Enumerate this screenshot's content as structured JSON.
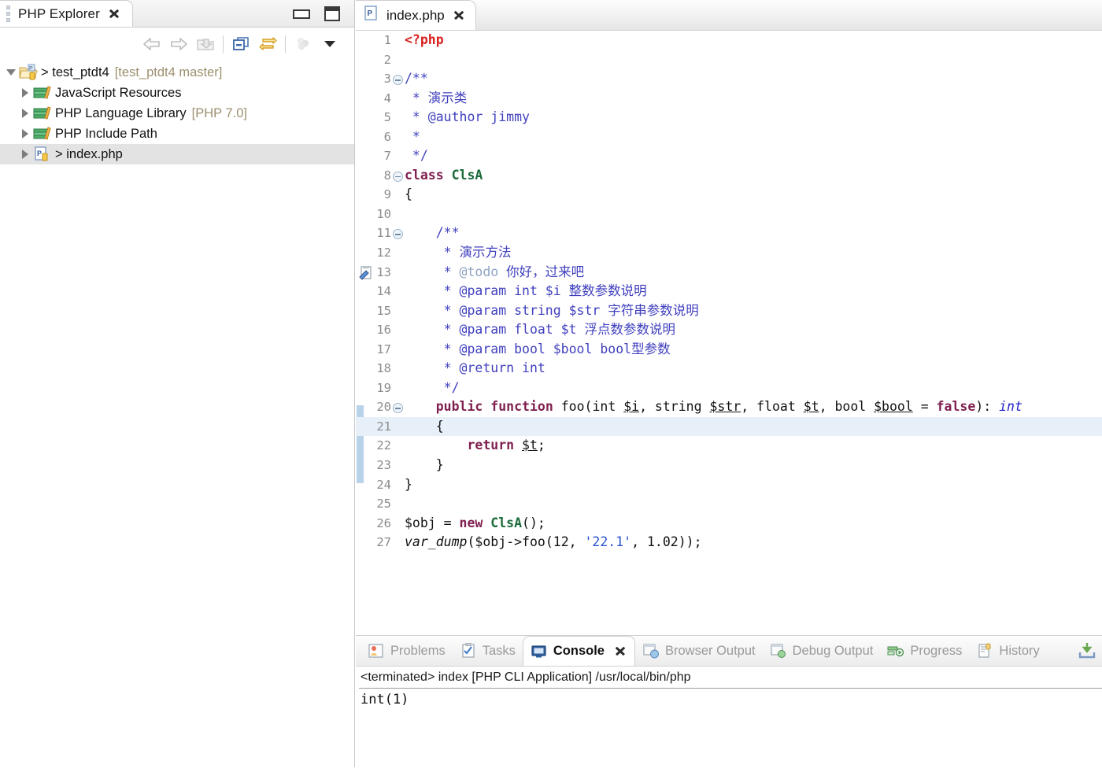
{
  "explorer": {
    "tab_title": "PHP Explorer",
    "close_icon": "close-x-icon",
    "view_menu_icon": "view-menu-icon",
    "window_controls": [
      {
        "name": "minimize-icon",
        "label": "Minimize"
      },
      {
        "name": "maximize-icon",
        "label": "Maximize"
      }
    ],
    "toolbar": [
      {
        "name": "back-icon",
        "label": "Back"
      },
      {
        "name": "forward-icon",
        "label": "Forward"
      },
      {
        "name": "up-folder-icon",
        "label": "Up"
      },
      {
        "name": "collapse-all-icon",
        "label": "Collapse All"
      },
      {
        "name": "link-with-editor-icon",
        "label": "Link with Editor"
      },
      {
        "name": "filters-icon",
        "label": "Filters"
      },
      {
        "name": "view-menu-chevron-icon",
        "label": "View Menu"
      }
    ],
    "tree": [
      {
        "label": "test_ptdt4",
        "prefix": "> ",
        "suffix": "[test_ptdt4 master]",
        "icon": "project-folder-icon",
        "expanded": true,
        "level": 0,
        "selected": false
      },
      {
        "label": "JavaScript Resources",
        "prefix": "",
        "suffix": "",
        "icon": "library-books-icon",
        "expanded": false,
        "level": 1,
        "selected": false
      },
      {
        "label": "PHP Language Library",
        "prefix": "",
        "suffix": "[PHP 7.0]",
        "icon": "library-books-icon",
        "expanded": false,
        "level": 1,
        "selected": false
      },
      {
        "label": "PHP Include Path",
        "prefix": "",
        "suffix": "",
        "icon": "library-books-icon",
        "expanded": false,
        "level": 1,
        "selected": false
      },
      {
        "label": "index.php",
        "prefix": "> ",
        "suffix": "",
        "icon": "php-file-icon",
        "expanded": false,
        "level": 1,
        "selected": true
      }
    ]
  },
  "editor": {
    "tab_title": "index.php",
    "tab_icon": "php-file-icon",
    "close_icon": "close-x-icon",
    "highlighted_line": 21,
    "change_bar_lines": [
      20,
      21,
      22,
      23
    ],
    "task_marker_line": 13,
    "fold_lines": [
      3,
      8,
      11,
      20
    ],
    "lines": [
      {
        "n": 1,
        "tokens": [
          {
            "t": "<?php",
            "c": "c-php"
          }
        ]
      },
      {
        "n": 2,
        "tokens": []
      },
      {
        "n": 3,
        "tokens": [
          {
            "t": "/**",
            "c": "c-com"
          }
        ]
      },
      {
        "n": 4,
        "tokens": [
          {
            "t": " * 演示类",
            "c": "c-com"
          }
        ]
      },
      {
        "n": 5,
        "tokens": [
          {
            "t": " * @author jimmy",
            "c": "c-com"
          }
        ]
      },
      {
        "n": 6,
        "tokens": [
          {
            "t": " *",
            "c": "c-com"
          }
        ]
      },
      {
        "n": 7,
        "tokens": [
          {
            "t": " */",
            "c": "c-com"
          }
        ]
      },
      {
        "n": 8,
        "tokens": [
          {
            "t": "class ",
            "c": "c-kw"
          },
          {
            "t": "ClsA",
            "c": "c-cls"
          }
        ]
      },
      {
        "n": 9,
        "tokens": [
          {
            "t": "{",
            "c": "c-plain"
          }
        ]
      },
      {
        "n": 10,
        "tokens": []
      },
      {
        "n": 11,
        "tokens": [
          {
            "t": "    /**",
            "c": "c-com"
          }
        ]
      },
      {
        "n": 12,
        "tokens": [
          {
            "t": "     * 演示方法",
            "c": "c-com"
          }
        ]
      },
      {
        "n": 13,
        "tokens": [
          {
            "t": "     * ",
            "c": "c-com"
          },
          {
            "t": "@todo",
            "c": "c-tag"
          },
          {
            "t": " 你好，过来吧",
            "c": "c-com"
          }
        ]
      },
      {
        "n": 14,
        "tokens": [
          {
            "t": "     * @param int $i 整数参数说明",
            "c": "c-com"
          }
        ]
      },
      {
        "n": 15,
        "tokens": [
          {
            "t": "     * @param string $str 字符串参数说明",
            "c": "c-com"
          }
        ]
      },
      {
        "n": 16,
        "tokens": [
          {
            "t": "     * @param float $t 浮点数参数说明",
            "c": "c-com"
          }
        ]
      },
      {
        "n": 17,
        "tokens": [
          {
            "t": "     * @param bool $bool bool型参数",
            "c": "c-com"
          }
        ]
      },
      {
        "n": 18,
        "tokens": [
          {
            "t": "     * @return int",
            "c": "c-com"
          }
        ]
      },
      {
        "n": 19,
        "tokens": [
          {
            "t": "     */",
            "c": "c-com"
          }
        ]
      },
      {
        "n": 20,
        "tokens": [
          {
            "t": "    ",
            "c": "c-plain"
          },
          {
            "t": "public",
            "c": "c-kw"
          },
          {
            "t": " ",
            "c": "c-plain"
          },
          {
            "t": "function",
            "c": "c-kw"
          },
          {
            "t": " foo(int ",
            "c": "c-plain"
          },
          {
            "t": "$i",
            "c": "c-var"
          },
          {
            "t": ", string ",
            "c": "c-plain"
          },
          {
            "t": "$str",
            "c": "c-var"
          },
          {
            "t": ", float ",
            "c": "c-plain"
          },
          {
            "t": "$t",
            "c": "c-var"
          },
          {
            "t": ", bool ",
            "c": "c-plain"
          },
          {
            "t": "$bool",
            "c": "c-var"
          },
          {
            "t": " = ",
            "c": "c-plain"
          },
          {
            "t": "false",
            "c": "c-kw"
          },
          {
            "t": "): ",
            "c": "c-plain"
          },
          {
            "t": "int",
            "c": "c-ret"
          }
        ]
      },
      {
        "n": 21,
        "tokens": [
          {
            "t": "    {",
            "c": "c-plain"
          }
        ]
      },
      {
        "n": 22,
        "tokens": [
          {
            "t": "        ",
            "c": "c-plain"
          },
          {
            "t": "return",
            "c": "c-kw"
          },
          {
            "t": " ",
            "c": "c-plain"
          },
          {
            "t": "$t",
            "c": "c-var"
          },
          {
            "t": ";",
            "c": "c-plain"
          }
        ]
      },
      {
        "n": 23,
        "tokens": [
          {
            "t": "    }",
            "c": "c-plain"
          }
        ]
      },
      {
        "n": 24,
        "tokens": [
          {
            "t": "}",
            "c": "c-plain"
          }
        ]
      },
      {
        "n": 25,
        "tokens": []
      },
      {
        "n": 26,
        "tokens": [
          {
            "t": "$obj = ",
            "c": "c-plain"
          },
          {
            "t": "new",
            "c": "c-kw"
          },
          {
            "t": " ",
            "c": "c-plain"
          },
          {
            "t": "ClsA",
            "c": "c-cls"
          },
          {
            "t": "();",
            "c": "c-plain"
          }
        ]
      },
      {
        "n": 27,
        "tokens": [
          {
            "t": "var_dump",
            "c": "c-fn"
          },
          {
            "t": "($obj->foo(12, ",
            "c": "c-plain"
          },
          {
            "t": "'22.1'",
            "c": "c-str"
          },
          {
            "t": ", 1.02));",
            "c": "c-plain"
          }
        ]
      }
    ]
  },
  "console": {
    "tabs": [
      {
        "label": "Problems",
        "icon": "problems-icon",
        "active": false
      },
      {
        "label": "Tasks",
        "icon": "tasks-icon",
        "active": false
      },
      {
        "label": "Console",
        "icon": "console-icon",
        "active": true
      },
      {
        "label": "Browser Output",
        "icon": "browser-output-icon",
        "active": false
      },
      {
        "label": "Debug Output",
        "icon": "debug-output-icon",
        "active": false
      },
      {
        "label": "Progress",
        "icon": "progress-icon",
        "active": false
      },
      {
        "label": "History",
        "icon": "history-icon",
        "active": false
      }
    ],
    "minimize_restore_icon": "minimize-tray-icon",
    "header": "<terminated> index [PHP CLI Application] /usr/local/bin/php",
    "output": "int(1)"
  },
  "colors": {
    "selection": "#e3e3e3",
    "line_highlight": "#e7eff9",
    "change_bar": "#b8d2ea",
    "php_tag": "#d7221f",
    "comment": "#3f3fbf",
    "keyword": "#7f1f4f",
    "class_name": "#1b6b3a",
    "string": "#2a52cf",
    "return_type": "#2222cc",
    "tree_suffix": "#9c8f6e"
  }
}
